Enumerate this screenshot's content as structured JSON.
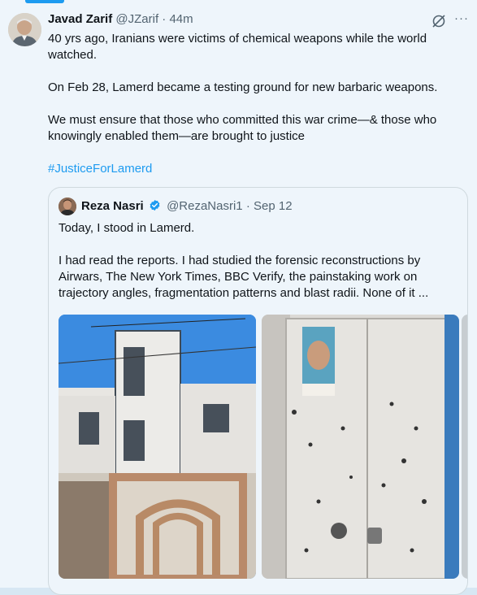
{
  "tweet": {
    "author_name": "Javad Zarif",
    "handle": "@JZarif",
    "separator": "·",
    "time": "44m",
    "more_icon": "ellipsis-icon",
    "grok_icon": "grok-icon",
    "paragraphs": [
      "40 yrs ago, Iranians were victims of chemical weapons while the world watched.",
      "On Feb 28, Lamerd became a testing ground for new barbaric weapons.",
      "We must ensure that those who committed this war crime—& those who knowingly enabled them—are brought to justice"
    ],
    "hashtag": "#JusticeForLamerd",
    "accent_color": "#1d9bf0"
  },
  "quote": {
    "author_name": "Reza Nasri",
    "verified_icon": "verified-badge-icon",
    "handle": "@RezaNasri1",
    "separator": "·",
    "date": "Sep 12",
    "paragraphs": [
      "Today, I stood in Lamerd.",
      "I had read the reports. I had studied the forensic reconstructions by Airwars, The New York Times, BBC Verify, the painstaking work on trajectory angles, fragmentation patterns and blast radii. None of it ..."
    ],
    "images": [
      "house-with-damaged-gate-photo",
      "bullet-riddled-door-photo",
      "third-photo-partial"
    ]
  }
}
